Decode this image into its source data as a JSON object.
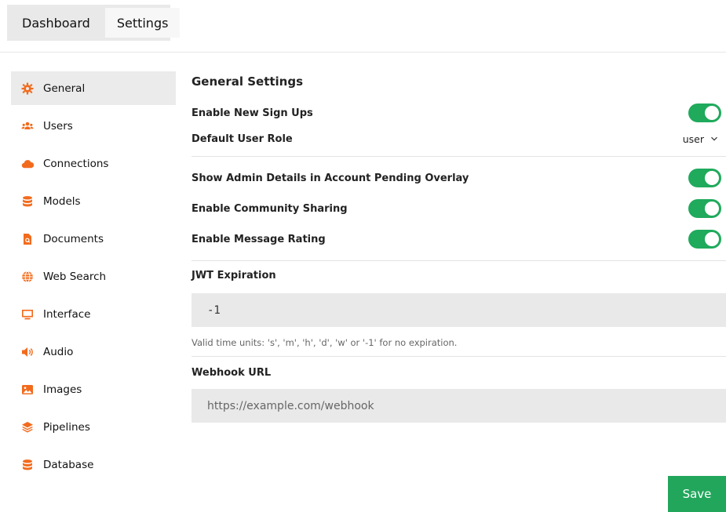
{
  "topnav": {
    "tabs": [
      {
        "label": "Dashboard"
      },
      {
        "label": "Settings"
      }
    ]
  },
  "sidebar": {
    "items": [
      {
        "label": "General",
        "icon": "gear-icon"
      },
      {
        "label": "Users",
        "icon": "users-icon"
      },
      {
        "label": "Connections",
        "icon": "cloud-icon"
      },
      {
        "label": "Models",
        "icon": "database-icon"
      },
      {
        "label": "Documents",
        "icon": "document-search-icon"
      },
      {
        "label": "Web Search",
        "icon": "globe-icon"
      },
      {
        "label": "Interface",
        "icon": "monitor-icon"
      },
      {
        "label": "Audio",
        "icon": "speaker-icon"
      },
      {
        "label": "Images",
        "icon": "image-icon"
      },
      {
        "label": "Pipelines",
        "icon": "layers-icon"
      },
      {
        "label": "Database",
        "icon": "database-icon"
      }
    ]
  },
  "general": {
    "title": "General Settings",
    "enable_signups": {
      "label": "Enable New Sign Ups",
      "value": true
    },
    "default_role": {
      "label": "Default User Role",
      "value": "user"
    },
    "show_admin_details": {
      "label": "Show Admin Details in Account Pending Overlay",
      "value": true
    },
    "community_sharing": {
      "label": "Enable Community Sharing",
      "value": true
    },
    "message_rating": {
      "label": "Enable Message Rating",
      "value": true
    },
    "jwt": {
      "label": "JWT Expiration",
      "value": "-1",
      "help": "Valid time units: 's', 'm', 'h', 'd', 'w' or '-1' for no expiration."
    },
    "webhook": {
      "label": "Webhook URL",
      "placeholder": "https://example.com/webhook",
      "value": ""
    }
  },
  "actions": {
    "save_label": "Save"
  },
  "colors": {
    "accent": "#22a65c",
    "icon": "#f26b1d"
  }
}
